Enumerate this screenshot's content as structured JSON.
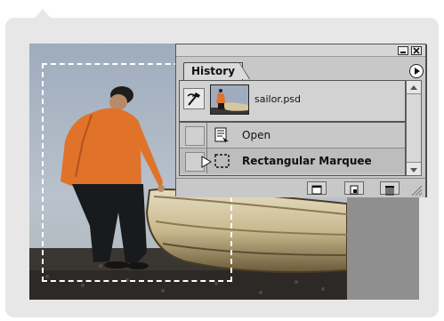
{
  "palette": {
    "tab_label": "History",
    "snapshot_label": "sailor.psd",
    "states": [
      {
        "label": "Open",
        "selected": false
      },
      {
        "label": "Rectangular Marquee",
        "selected": true
      }
    ]
  },
  "icons": {
    "minimize": "minimize-icon",
    "close": "close-icon",
    "palette_menu": "palette-menu-icon",
    "history_brush": "history-brush-icon",
    "open_state": "open-document-icon",
    "marquee_state": "rectangular-marquee-icon",
    "new_document": "new-document-from-state-icon",
    "new_snapshot": "new-snapshot-icon",
    "delete": "trash-icon"
  },
  "colors": {
    "palette_bg": "#c8c8c8",
    "frame_bg": "#e7e7e7",
    "document_gray": "#8f8f8f"
  }
}
